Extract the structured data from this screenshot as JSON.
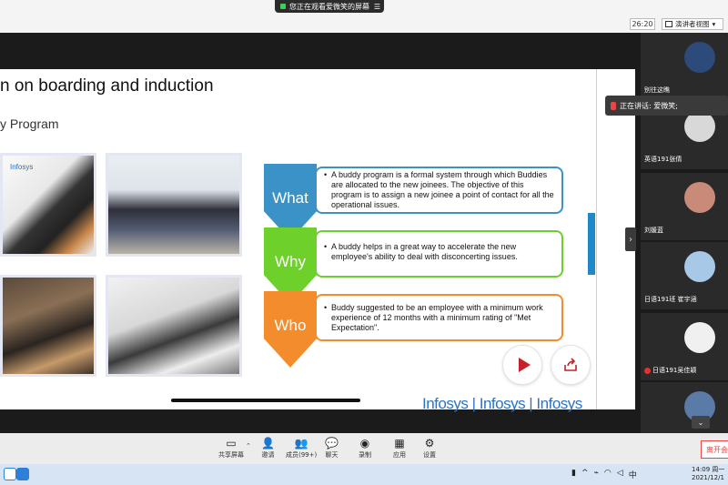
{
  "top": {
    "share_status": "您正在观看爱微笑的屏幕",
    "timer": "26:20",
    "presenter_view": "演讲者视图",
    "menu_glyph": "☰"
  },
  "slide": {
    "title": "n on boarding and induction",
    "subtitle": "y Program",
    "photo1_label": "Infosys",
    "chevrons": {
      "what": "What",
      "why": "Why",
      "who": "Who"
    },
    "boxes": {
      "what": "A buddy program is a formal system through which Buddies are allocated to the new joinees. The objective of this program is to assign a new joinee a point of contact for all the operational issues.",
      "why": "A buddy helps in a great way to accelerate the new employee's ability to deal with disconcerting issues.",
      "who": "Buddy suggested to be an employee with a minimum work experience of 12 months with a minimum rating of \"Met Expectation\"."
    },
    "logos": "Infosys | Infosys | Infosys"
  },
  "participants": [
    {
      "name": "别往这瞧",
      "color": "#2c4a7a"
    },
    {
      "name": "英语191张倩",
      "color": "#d8d8d8"
    },
    {
      "name": "刘媛蓝",
      "color": "#c98a7a"
    },
    {
      "name": "日语191班 崔宇涵",
      "color": "#a8c8e8"
    },
    {
      "name": "日语191吴佳颖",
      "color": "#f0f0f0"
    },
    {
      "name": "",
      "color": "#5a7aa8"
    }
  ],
  "speaking": {
    "label": "正在讲话: 爱微笑;"
  },
  "toolbar": {
    "share": "共享屏幕",
    "invite": "邀请",
    "members": "成员(99+)",
    "chat": "聊天",
    "record": "录制",
    "apps": "应用",
    "settings": "设置",
    "exit": "离开会"
  },
  "taskbar": {
    "time": "14:09 周一",
    "date": "2021/12/1",
    "ime": "中"
  }
}
